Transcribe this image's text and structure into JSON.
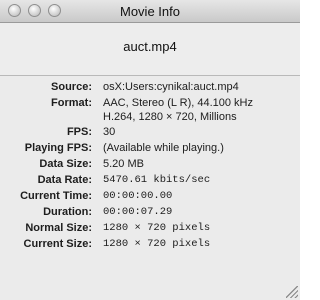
{
  "window": {
    "title": "Movie Info",
    "filename": "auct.mp4"
  },
  "info": [
    {
      "label": "Source:",
      "value": [
        "osX:Users:cynikal:auct.mp4"
      ],
      "font": "sans"
    },
    {
      "label": "Format:",
      "value": [
        "AAC, Stereo (L R), 44.100 kHz",
        "H.264, 1280 × 720, Millions"
      ],
      "font": "sans"
    },
    {
      "label": "FPS:",
      "value": [
        "30"
      ],
      "font": "sans"
    },
    {
      "label": "Playing FPS:",
      "value": [
        "(Available while playing.)"
      ],
      "font": "sans"
    },
    {
      "label": "Data Size:",
      "value": [
        "5.20 MB"
      ],
      "font": "sans"
    },
    {
      "label": "Data Rate:",
      "value": [
        "5470.61 kbits/sec"
      ],
      "font": "mono"
    },
    {
      "label": "Current Time:",
      "value": [
        "00:00:00.00"
      ],
      "font": "mono"
    },
    {
      "label": "Duration:",
      "value": [
        "00:00:07.29"
      ],
      "font": "mono"
    },
    {
      "label": "Normal Size:",
      "value": [
        "1280 × 720  pixels"
      ],
      "font": "mono"
    },
    {
      "label": "Current Size:",
      "value": [
        "1280 × 720  pixels"
      ],
      "font": "mono"
    }
  ],
  "icons": {
    "close": "close-button-icon",
    "minimize": "minimize-button-icon",
    "zoom": "zoom-button-icon",
    "resize": "resize-grip-icon"
  }
}
